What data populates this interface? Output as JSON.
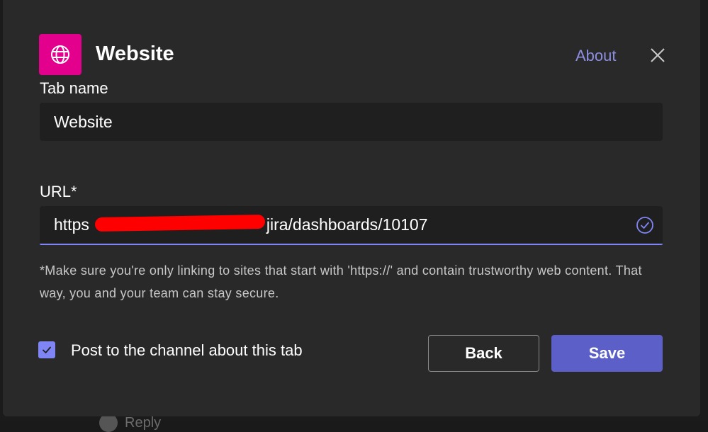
{
  "header": {
    "title": "Website",
    "about_label": "About",
    "icon": "globe-icon",
    "close_icon": "close-icon",
    "accent_color": "#e3008c"
  },
  "tab_name": {
    "label": "Tab name",
    "value": "Website"
  },
  "url": {
    "label": "URL*",
    "value_prefix": "https",
    "value_suffix": "jira/dashboards/10107",
    "status_icon": "check-circle-icon"
  },
  "helper_text": "*Make sure you're only linking to sites that start with 'https://' and contain trustworthy web content. That way, you and your team can stay secure.",
  "post_to_channel": {
    "label": "Post to the channel about this tab",
    "checked": true
  },
  "buttons": {
    "back_label": "Back",
    "save_label": "Save",
    "primary_color": "#5b5fc7"
  },
  "background": {
    "reply_label": "Reply"
  }
}
